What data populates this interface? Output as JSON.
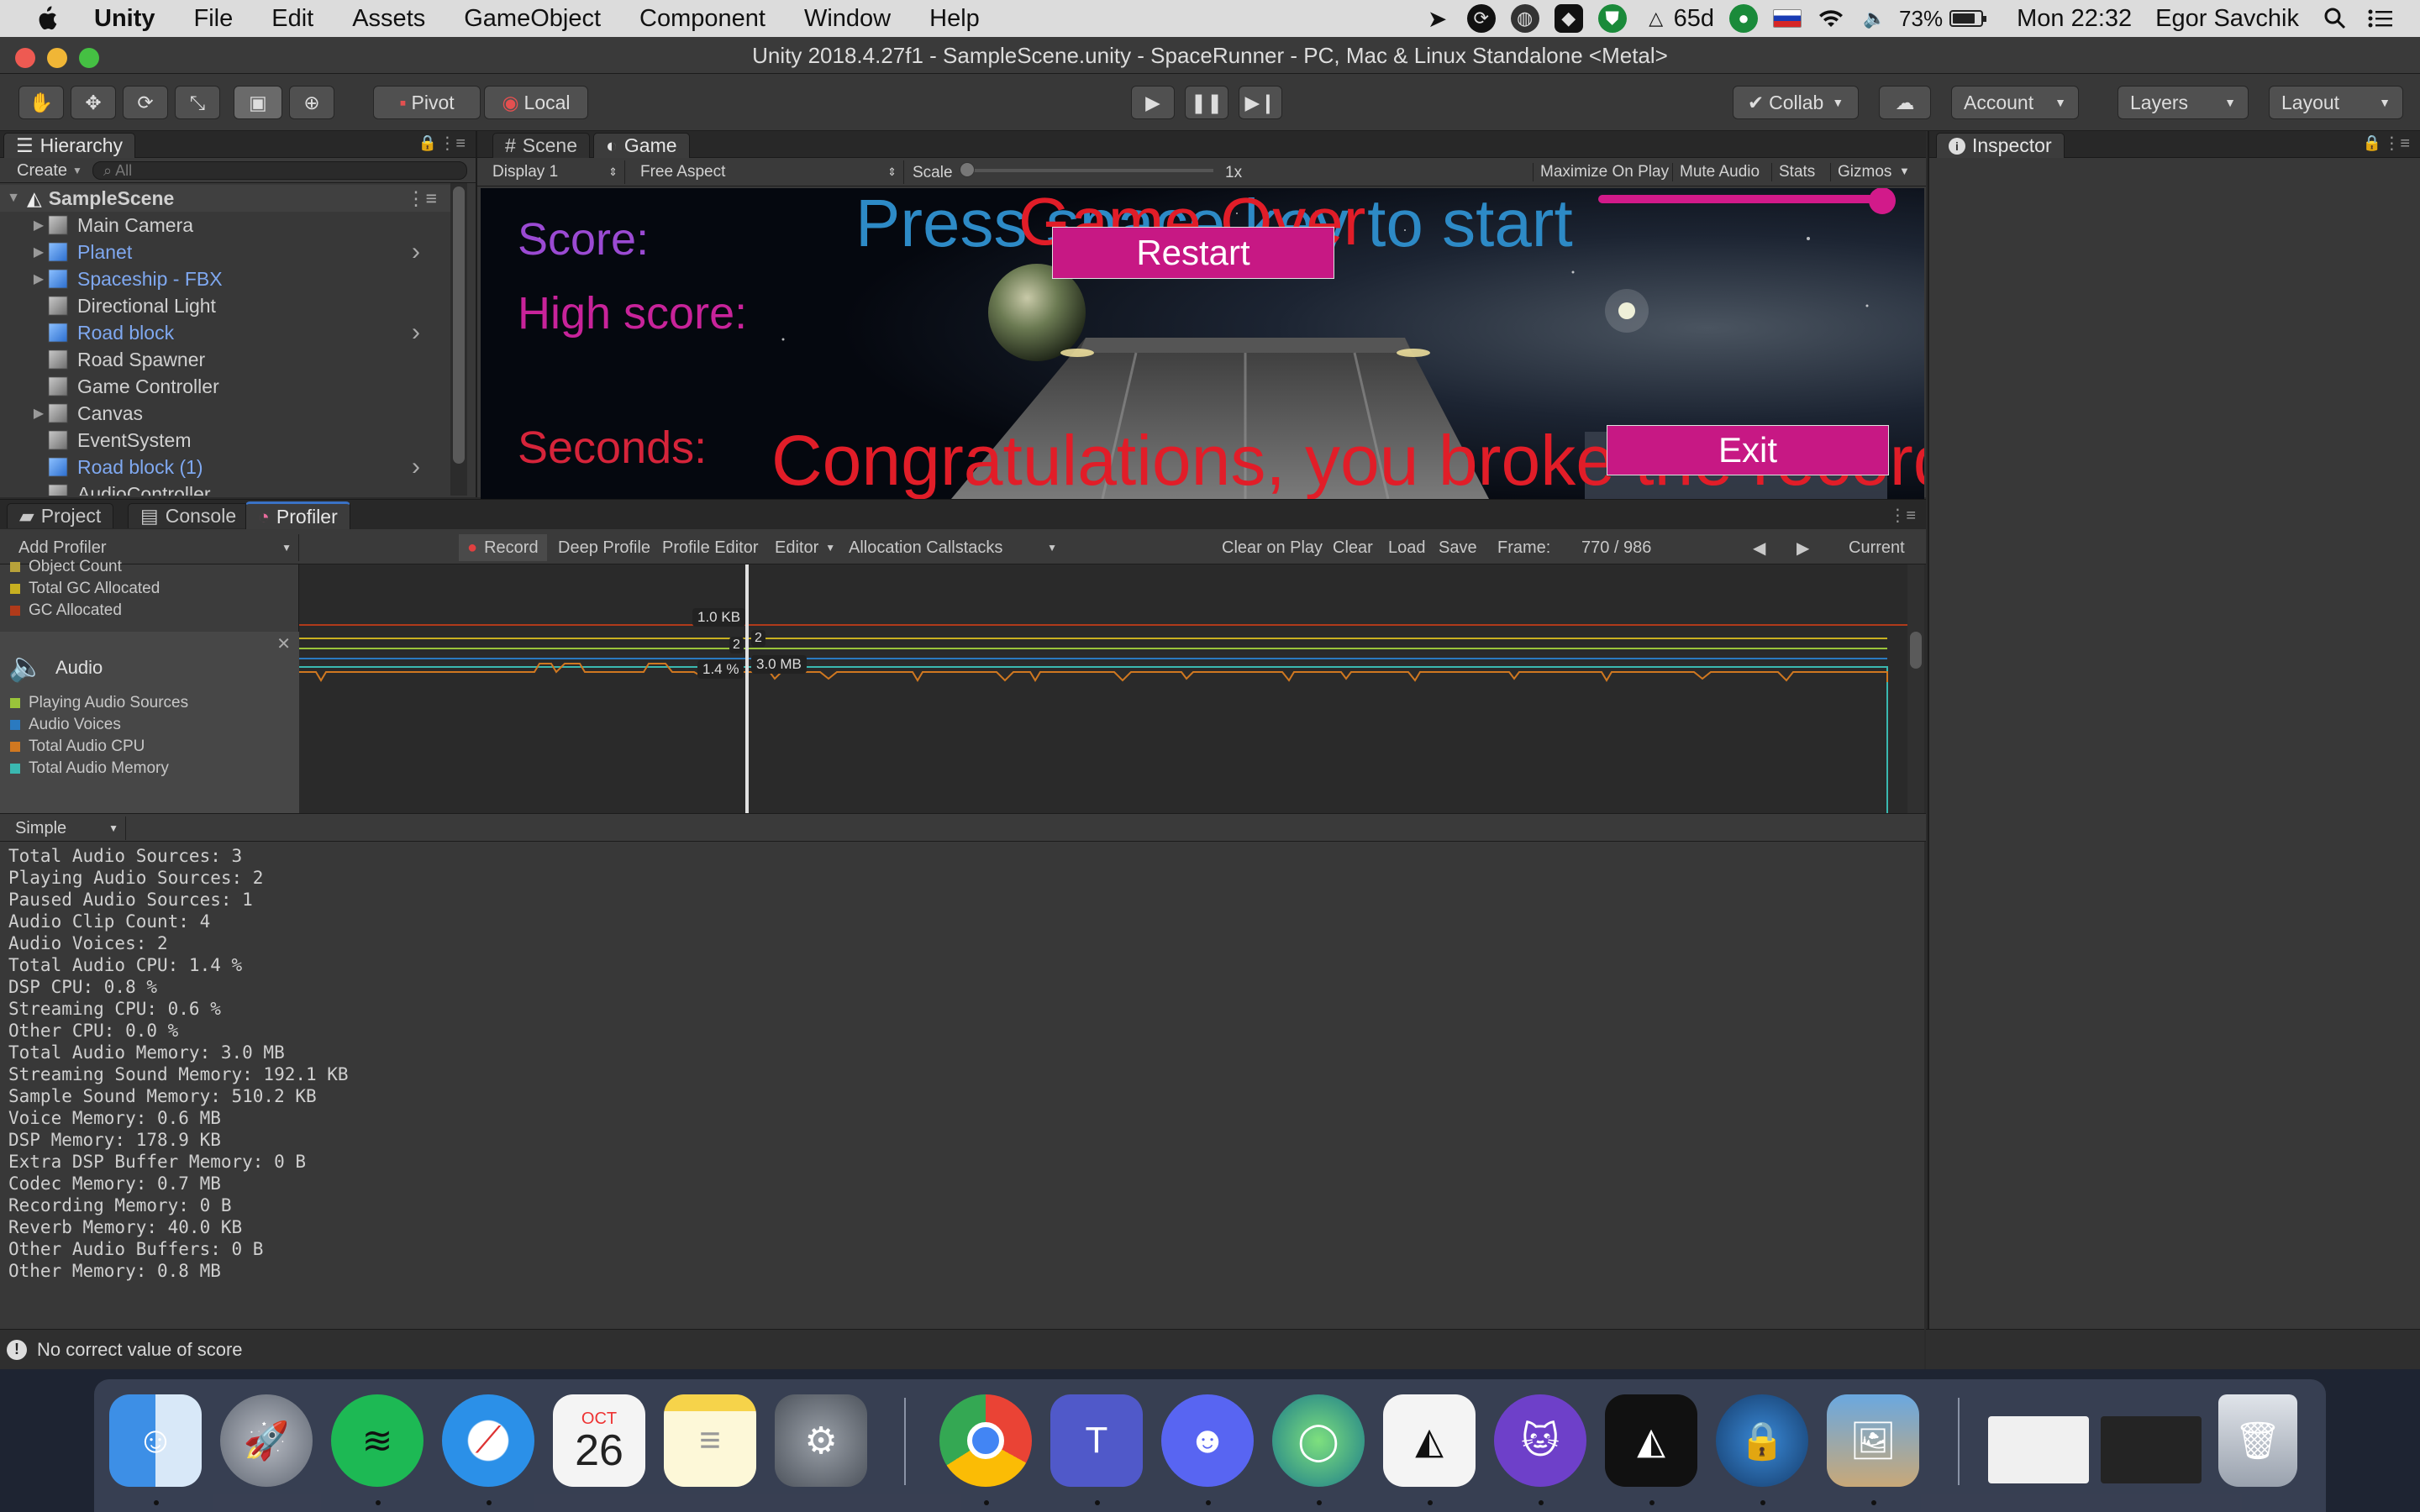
{
  "menubar": {
    "app_name": "Unity",
    "items": [
      "File",
      "Edit",
      "Assets",
      "GameObject",
      "Component",
      "Window",
      "Help"
    ],
    "weather": "65d",
    "battery": "73%",
    "clock": "Mon 22:32",
    "user": "Egor Savchik"
  },
  "window": {
    "title": "Unity 2018.4.27f1 - SampleScene.unity - SpaceRunner - PC, Mac & Linux Standalone <Metal>"
  },
  "toolbar": {
    "pivot": "Pivot",
    "local": "Local",
    "collab": "Collab",
    "account": "Account",
    "layers": "Layers",
    "layout": "Layout"
  },
  "hierarchy": {
    "tab": "Hierarchy",
    "create": "Create",
    "search_placeholder": "All",
    "scene": "SampleScene",
    "items": [
      {
        "label": "Main Camera",
        "prefab": false,
        "expandable": true
      },
      {
        "label": "Planet",
        "prefab": true,
        "expandable": true
      },
      {
        "label": "Spaceship - FBX",
        "prefab": true,
        "expandable": true
      },
      {
        "label": "Directional Light",
        "prefab": false,
        "expandable": false
      },
      {
        "label": "Road block",
        "prefab": true,
        "expandable": false
      },
      {
        "label": "Road Spawner",
        "prefab": false,
        "expandable": false
      },
      {
        "label": "Game Controller",
        "prefab": false,
        "expandable": false
      },
      {
        "label": "Canvas",
        "prefab": false,
        "expandable": true
      },
      {
        "label": "EventSystem",
        "prefab": false,
        "expandable": false
      },
      {
        "label": "Road block (1)",
        "prefab": true,
        "expandable": false
      },
      {
        "label": "AudioController",
        "prefab": false,
        "expandable": false
      }
    ]
  },
  "game_tabs": {
    "scene": "Scene",
    "game": "Game",
    "display": "Display 1",
    "aspect": "Free Aspect",
    "scale_label": "Scale",
    "scale_value": "1x",
    "maximize": "Maximize On Play",
    "mute": "Mute Audio",
    "stats": "Stats",
    "gizmos": "Gizmos"
  },
  "game": {
    "score": "Score:",
    "high_score": "High score:",
    "seconds": "Seconds:",
    "press_start": "Press space key to start",
    "game_over": "Game Over",
    "restart": "Restart",
    "congrats": "Congratulations, you broke the record!",
    "exit": "Exit"
  },
  "inspector": {
    "tab": "Inspector"
  },
  "bottom_tabs": {
    "project": "Project",
    "console": "Console",
    "profiler": "Profiler"
  },
  "profiler": {
    "add_profiler": "Add Profiler",
    "record": "Record",
    "deep_profile": "Deep Profile",
    "profile_editor": "Profile Editor",
    "editor": "Editor",
    "alloc_callstacks": "Allocation Callstacks",
    "clear_on_play": "Clear on Play",
    "clear": "Clear",
    "load": "Load",
    "save": "Save",
    "frame_label": "Frame:",
    "frame_value": "770 / 986",
    "current": "Current",
    "memory_legend": [
      {
        "label": "Object Count",
        "color": "#b8a23a"
      },
      {
        "label": "Total GC Allocated",
        "color": "#c8b020"
      },
      {
        "label": "GC Allocated",
        "color": "#b03a1a"
      }
    ],
    "audio_title": "Audio",
    "audio_legend": [
      {
        "label": "Playing Audio Sources",
        "color": "#9ac43a"
      },
      {
        "label": "Audio Voices",
        "color": "#2a7ac0"
      },
      {
        "label": "Total Audio CPU",
        "color": "#d07820"
      },
      {
        "label": "Total Audio Memory",
        "color": "#3ab8b0"
      }
    ],
    "tooltips": {
      "gc": "1.0 KB",
      "voices": "2",
      "sources": "2",
      "cpu": "1.4 %",
      "mem": "3.0 MB"
    },
    "view_mode": "Simple",
    "stats": [
      "Total Audio Sources: 3",
      "Playing Audio Sources: 2",
      "Paused Audio Sources: 1",
      "Audio Clip Count: 4",
      "Audio Voices: 2",
      "Total Audio CPU: 1.4 %",
      "DSP CPU: 0.8 %",
      "Streaming CPU: 0.6 %",
      "Other CPU: 0.0 %",
      "Total Audio Memory: 3.0 MB",
      "Streaming Sound Memory: 192.1 KB",
      "Sample Sound Memory: 510.2 KB",
      "Voice Memory: 0.6 MB",
      "DSP Memory: 178.9 KB",
      "Extra DSP Buffer Memory: 0 B",
      "Codec Memory: 0.7 MB",
      "Recording Memory: 0 B",
      "Reverb Memory: 40.0 KB",
      "Other Audio Buffers: 0 B",
      "Other Memory: 0.8 MB"
    ]
  },
  "status": {
    "message": "No correct value of score"
  },
  "dock": {
    "calendar_month": "OCT",
    "calendar_day": "26",
    "apps": [
      "finder",
      "launchpad",
      "spotify",
      "safari",
      "calendar",
      "notes",
      "system-preferences",
      "chrome",
      "teams",
      "discord",
      "webex",
      "unity-hub",
      "github-desktop",
      "unity",
      "lock-app",
      "preview",
      "window-thumb-1",
      "window-thumb-2",
      "trash"
    ]
  }
}
